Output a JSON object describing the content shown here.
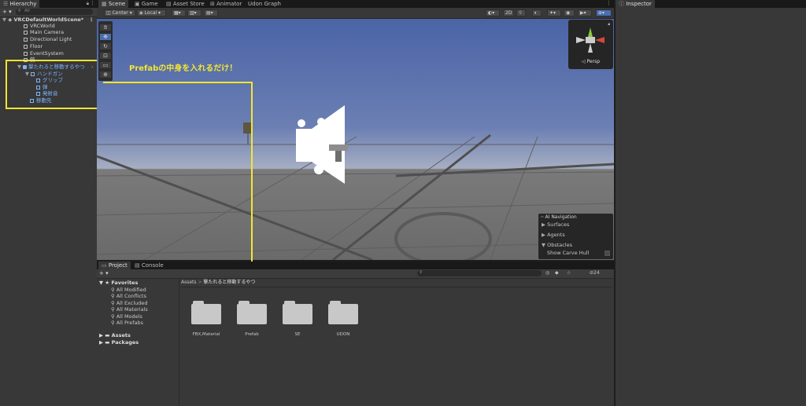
{
  "hierarchy": {
    "tab": "Hierarchy",
    "add_label": "+ ▾",
    "search_placeholder": "All",
    "scene_name": "VRCDefaultWorldScene*",
    "items": [
      {
        "label": "VRCWorld"
      },
      {
        "label": "Main Camera"
      },
      {
        "label": "Directional Light"
      },
      {
        "label": "Floor"
      },
      {
        "label": "EventSystem"
      },
      {
        "label": "銃"
      },
      {
        "label": "撃たれると移動するやつ"
      },
      {
        "label": "ハンドガン"
      },
      {
        "label": "グリップ"
      },
      {
        "label": "弾"
      },
      {
        "label": "発射音"
      },
      {
        "label": "移動先"
      }
    ]
  },
  "top_tabs": {
    "scene": "Scene",
    "game": "Game",
    "asset_store": "Asset Store",
    "animator": "Animator",
    "udon_graph": "Udon Graph"
  },
  "scene_toolbar": {
    "pivot": "Center",
    "space": "Local",
    "mode_2d": "2D"
  },
  "annotation": {
    "text": "Prefabの中身を入れるだけ！",
    "color": "#f5e530"
  },
  "gizmo": {
    "persp": "Persp"
  },
  "ai_navigation": {
    "title": "AI Navigation",
    "items": [
      "Surfaces",
      "Agents",
      "Obstacles"
    ],
    "toggle_label": "Show Carve Hull"
  },
  "project": {
    "tab_project": "Project",
    "tab_console": "Console",
    "add_label": "+ ▾",
    "hidden_count": "24",
    "breadcrumb": {
      "root": "Assets",
      "sep": ">",
      "current": "撃たれると移動するやつ"
    },
    "favorites_label": "Favorites",
    "favorites": [
      "All Modified",
      "All Conflicts",
      "All Excluded",
      "All Materials",
      "All Models",
      "All Prefabs"
    ],
    "roots": [
      "Assets",
      "Packages"
    ],
    "folders": [
      "FBX,Material",
      "Prefab",
      "SE",
      "UDON"
    ]
  },
  "inspector": {
    "tab": "Inspector"
  },
  "colors": {
    "accent_blue": "#7fb3ff",
    "annotation_yellow": "#f5e530",
    "sky_top": "#4c66a8",
    "ground": "#6a6a6a"
  }
}
